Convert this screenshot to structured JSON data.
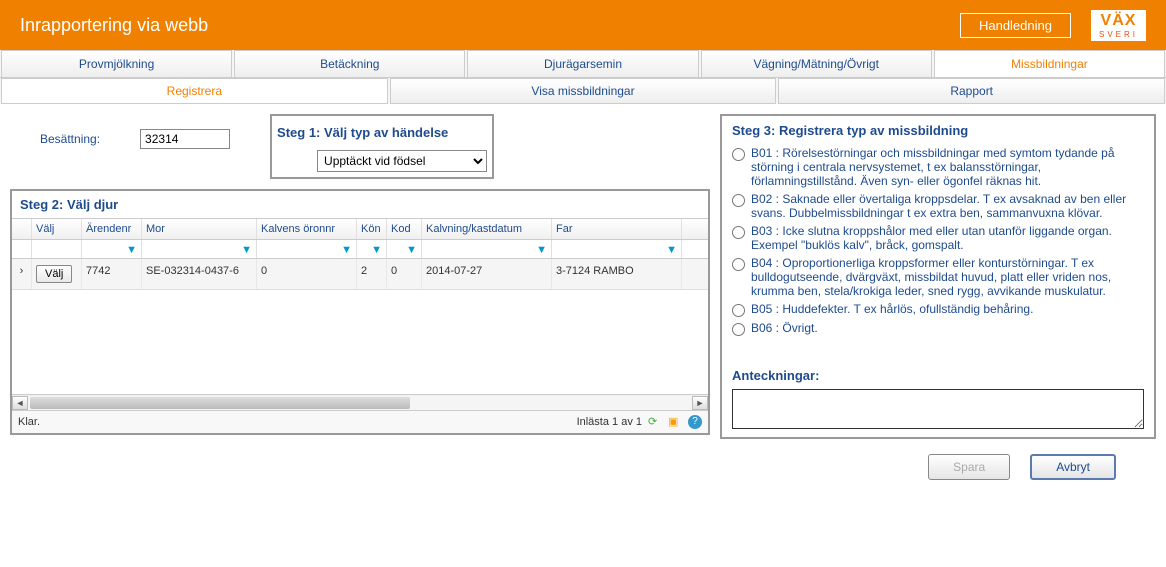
{
  "header": {
    "title": "Inrapportering via webb",
    "handledning": "Handledning",
    "logo": "VÄX",
    "logo_sub": "SVERI"
  },
  "tabs": [
    "Provmjölkning",
    "Betäckning",
    "Djurägarsemin",
    "Vägning/Mätning/Övrigt",
    "Missbildningar"
  ],
  "active_tab": 4,
  "subtabs": [
    "Registrera",
    "Visa missbildningar",
    "Rapport"
  ],
  "active_subtab": 0,
  "besattning": {
    "label": "Besättning:",
    "value": "32314"
  },
  "step1": {
    "title": "Steg 1: Välj typ av händelse",
    "selected": "Upptäckt vid födsel"
  },
  "step2": {
    "title": "Steg 2: Välj djur",
    "columns": [
      "Välj",
      "Ärendenr",
      "Mor",
      "Kalvens öronnr",
      "Kön",
      "Kod",
      "Kalvning/kastdatum",
      "Far"
    ],
    "valj_btn": "Välj",
    "row": {
      "arendenr": "7742",
      "mor": "SE-032314-0437-6",
      "kalvens": "0",
      "kon": "2",
      "kod": "0",
      "kalvning": "2014-07-27",
      "far": "3-7124 RAMBO"
    },
    "footer_left": "Klar.",
    "footer_right": "Inlästa 1 av 1"
  },
  "step3": {
    "title": "Steg 3: Registrera typ av missbildning",
    "options": [
      "B01 : Rörelsestörningar och missbildningar med symtom tydande på störning i centrala nervsystemet, t ex balansstörningar, förlamningstillstånd. Även syn- eller ögonfel räknas hit.",
      "B02 : Saknade eller övertaliga kroppsdelar. T ex avsaknad av ben eller svans. Dubbelmissbildningar t ex extra ben, sammanvuxna klövar.",
      "B03 : Icke slutna kroppshålor med eller utan utanför liggande organ. Exempel \"buklös kalv\", bråck, gomspalt.",
      "B04 : Oproportionerliga kroppsformer eller konturstörningar. T ex bulldogutseende, dvärgväxt, missbildat huvud, platt eller vriden nos, krumma ben, stela/krokiga leder, sned rygg, avvikande muskulatur.",
      "B05 : Huddefekter. T ex hårlös, ofullständig behåring.",
      "B06 : Övrigt."
    ],
    "anteckningar_label": "Anteckningar:"
  },
  "buttons": {
    "spara": "Spara",
    "avbryt": "Avbryt"
  }
}
